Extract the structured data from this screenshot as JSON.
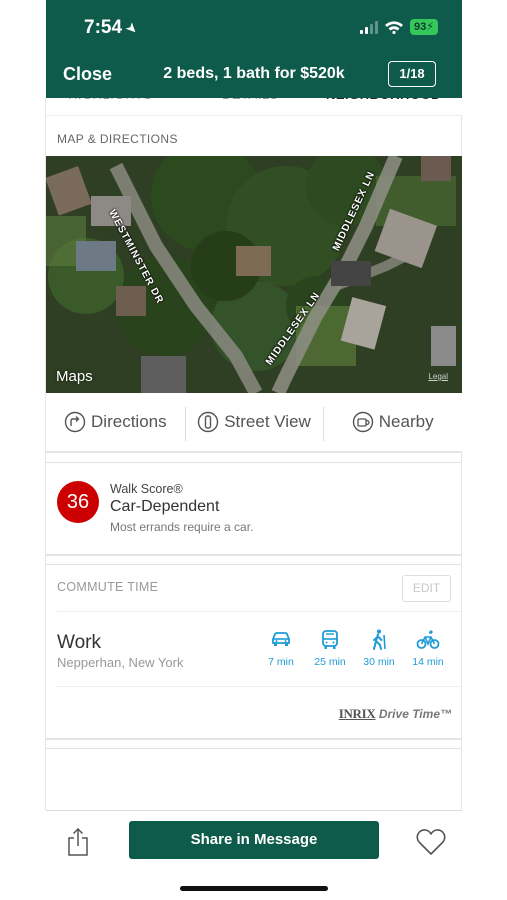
{
  "status_bar": {
    "time": "7:54",
    "battery": "93"
  },
  "header": {
    "close_label": "Close",
    "title": "2 beds, 1 bath for $520k",
    "page_indicator": "1/18"
  },
  "tabs": [
    "HIGHLIGHTS",
    "DETAILS",
    "NEIGHBORHOOD"
  ],
  "map_section": {
    "title": "MAP & DIRECTIONS",
    "street_labels": [
      "WESTMINSTER DR",
      "MIDDLESEX LN",
      "MIDDLESEX LN"
    ],
    "maps_label": "Maps",
    "legal_label": "Legal",
    "actions": [
      {
        "label": "Directions",
        "icon": "directions-icon"
      },
      {
        "label": "Street View",
        "icon": "street-view-icon"
      },
      {
        "label": "Nearby",
        "icon": "nearby-icon"
      }
    ]
  },
  "walk_score": {
    "score": "36",
    "label": "Walk Score®",
    "title": "Car-Dependent",
    "description": "Most errands require a car.",
    "score_color": "#cc0000"
  },
  "commute": {
    "heading": "COMMUTE TIME",
    "edit_label": "EDIT",
    "destination": "Work",
    "location": "Nepperhan, New York",
    "modes": [
      {
        "icon": "car-icon",
        "time": "7 min"
      },
      {
        "icon": "bus-icon",
        "time": "25 min"
      },
      {
        "icon": "walk-icon",
        "time": "30 min"
      },
      {
        "icon": "bike-icon",
        "time": "14 min"
      }
    ],
    "provider_brand": "INRIX",
    "provider_product": "Drive Time™"
  },
  "bottom_bar": {
    "share_message_label": "Share in Message"
  },
  "colors": {
    "brand_green": "#0f5b4b",
    "commute_blue": "#1e9bd7"
  }
}
